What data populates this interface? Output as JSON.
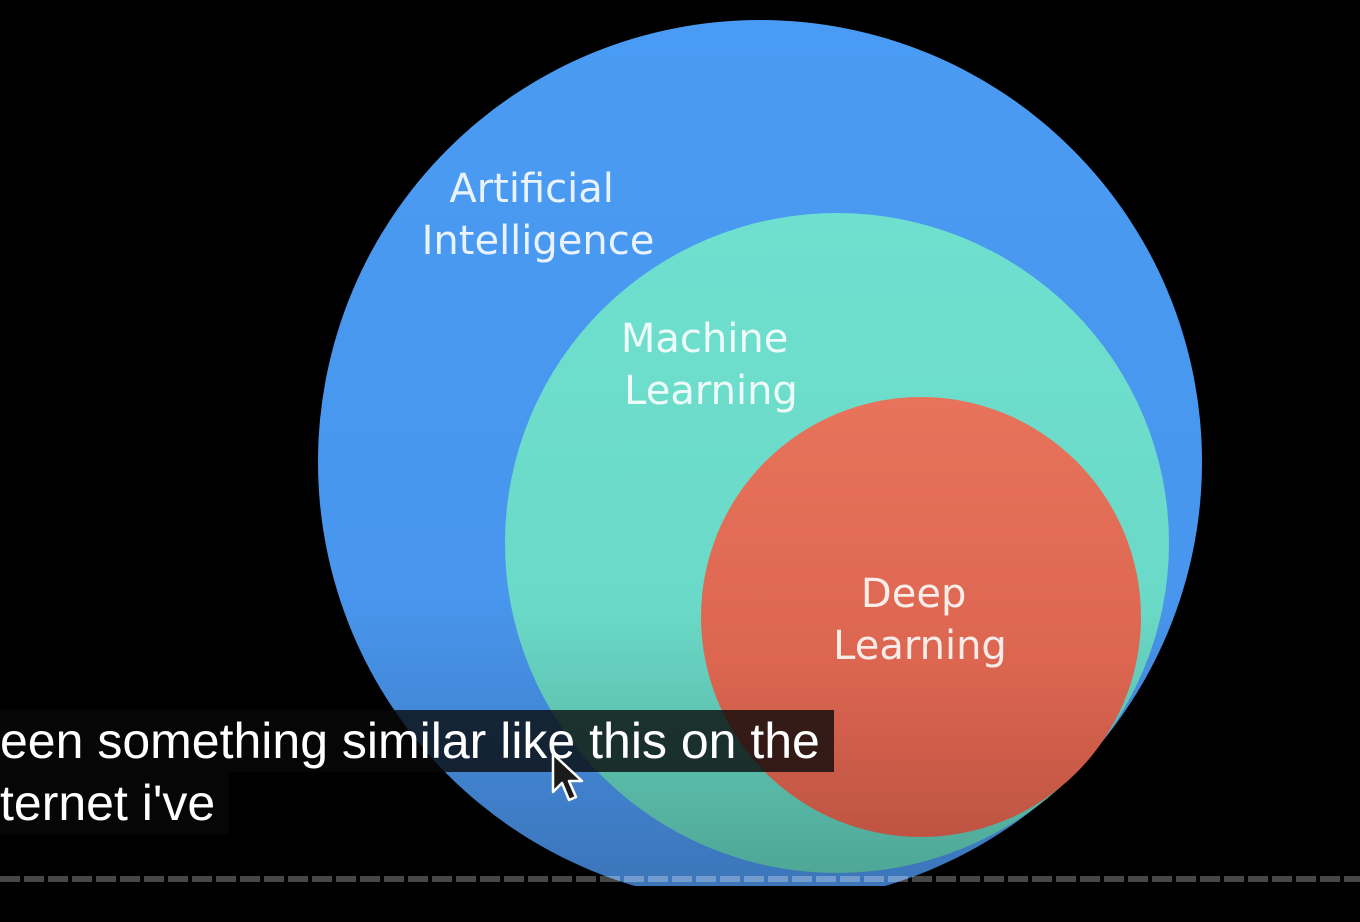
{
  "diagram": {
    "outer_label": [
      "Artificial",
      "Intelligence"
    ],
    "middle_label": [
      "Machine",
      "Learning"
    ],
    "inner_label": [
      "Deep",
      "Learning"
    ],
    "colors": {
      "outer": "#4a9bf3",
      "middle": "#6fe0cf",
      "inner": "#e86d56"
    }
  },
  "captions": {
    "line1": "een something similar like this on the",
    "line2": "ternet i've"
  },
  "icons": {
    "cursor": "mouse-pointer-icon"
  }
}
